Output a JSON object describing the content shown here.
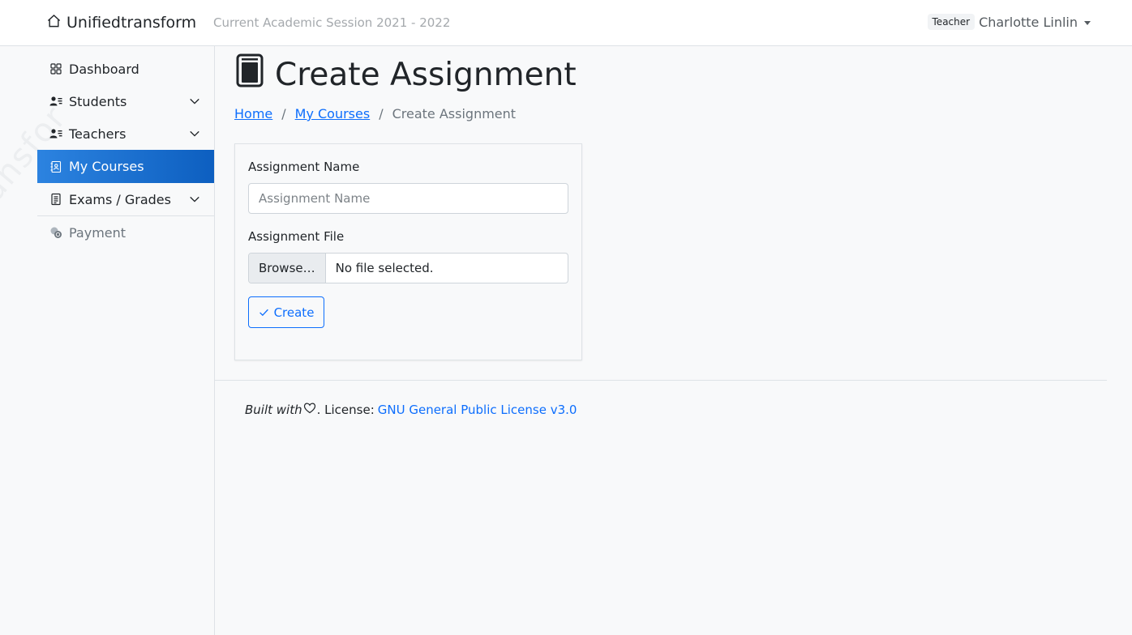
{
  "navbar": {
    "brand": "Unifiedtransform",
    "session": "Current Academic Session 2021 - 2022",
    "role_badge": "Teacher",
    "username": "Charlotte Linlin"
  },
  "sidebar": {
    "watermark": "unsfor",
    "items": [
      {
        "label": "Dashboard",
        "icon": "grid-icon",
        "expandable": false
      },
      {
        "label": "Students",
        "icon": "person-lines-icon",
        "expandable": true
      },
      {
        "label": "Teachers",
        "icon": "person-lines-icon",
        "expandable": true
      },
      {
        "label": "My Courses",
        "icon": "journal-person-icon",
        "active": true
      },
      {
        "label": "Exams / Grades",
        "icon": "file-text-icon",
        "expandable": true
      },
      {
        "label": "Payment",
        "icon": "coins-icon",
        "disabled": true
      }
    ]
  },
  "page": {
    "title": "Create Assignment",
    "title_icon": "book-icon",
    "breadcrumb": {
      "home": "Home",
      "courses": "My Courses",
      "current": "Create Assignment",
      "separator": "/"
    }
  },
  "form": {
    "name_label": "Assignment Name",
    "name_placeholder": "Assignment Name",
    "name_value": "",
    "file_label": "Assignment File",
    "browse_label": "Browse…",
    "file_status": "No file selected.",
    "submit_label": "Create"
  },
  "footer": {
    "built_with": "Built with",
    "license_prefix": ". License:",
    "license_link": "GNU General Public License v3.0"
  },
  "colors": {
    "accent": "#0d6efd",
    "active_start": "#2c83e0",
    "active_end": "#0d5fc0"
  }
}
